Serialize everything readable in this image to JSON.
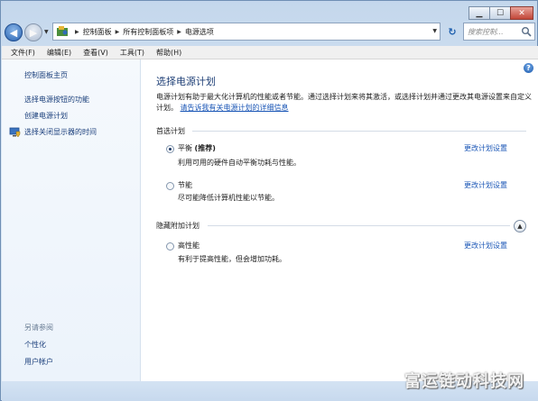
{
  "window": {
    "controls": {
      "minimize": "▁",
      "maximize": "☐",
      "close": "✕"
    }
  },
  "nav": {
    "back": "◀",
    "forward": "▶",
    "breadcrumb": [
      "控制面板",
      "所有控制面板项",
      "电源选项"
    ],
    "search_placeholder": "搜索控制..."
  },
  "menubar": [
    "文件(F)",
    "编辑(E)",
    "查看(V)",
    "工具(T)",
    "帮助(H)"
  ],
  "sidebar": {
    "home": "控制面板主页",
    "links": [
      "选择电源按钮的功能",
      "创建电源计划",
      "选择关闭显示器的时间"
    ],
    "see_also_title": "另请参阅",
    "see_also": [
      "个性化",
      "用户帐户"
    ]
  },
  "main": {
    "title": "选择电源计划",
    "description": "电源计划有助于最大化计算机的性能或者节能。通过选择计划来将其激活，或选择计划并通过更改其电源设置来自定义计划。",
    "description_link": "请告诉我有关电源计划的详细信息",
    "preferred_label": "首选计划",
    "hidden_label": "隐藏附加计划",
    "change_label": "更改计划设置",
    "plans": [
      {
        "name": "平衡",
        "tag": "(推荐)",
        "desc": "利用可用的硬件自动平衡功耗与性能。",
        "selected": true
      },
      {
        "name": "节能",
        "tag": "",
        "desc": "尽可能降低计算机性能以节能。",
        "selected": false
      },
      {
        "name": "高性能",
        "tag": "",
        "desc": "有利于提高性能，但会增加功耗。",
        "selected": false
      }
    ]
  },
  "watermark": "富运链动科技网",
  "colors": {
    "accent": "#1e3f76",
    "link": "#1a56b6",
    "sidebar_link": "#1b3f7b"
  }
}
